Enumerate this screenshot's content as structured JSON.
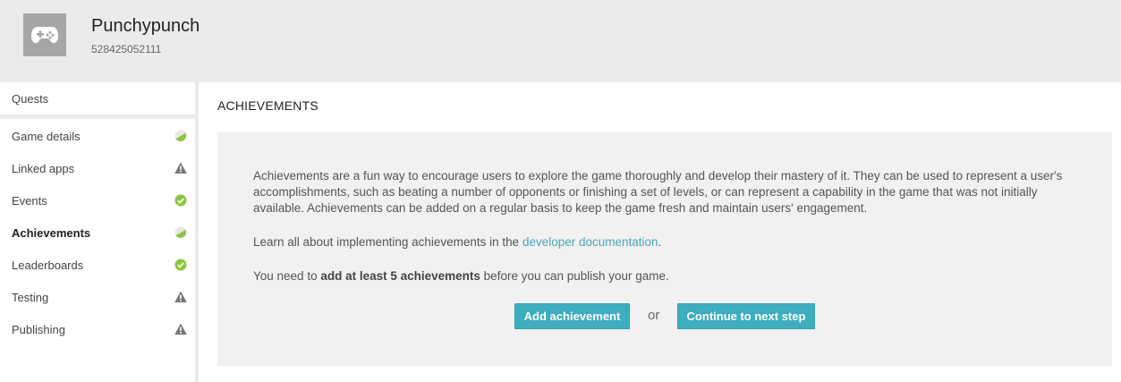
{
  "header": {
    "title": "Punchypunch",
    "game_id": "528425052111",
    "icon": "gamepad-icon"
  },
  "sidebar": {
    "quests_label": "Quests",
    "items": [
      {
        "label": "Game details",
        "status": "partial"
      },
      {
        "label": "Linked apps",
        "status": "warning"
      },
      {
        "label": "Events",
        "status": "complete"
      },
      {
        "label": "Achievements",
        "status": "partial",
        "active": true
      },
      {
        "label": "Leaderboards",
        "status": "complete"
      },
      {
        "label": "Testing",
        "status": "warning"
      },
      {
        "label": "Publishing",
        "status": "warning"
      }
    ]
  },
  "main": {
    "section_title": "ACHIEVEMENTS",
    "description": "Achievements are a fun way to encourage users to explore the game thoroughly and develop their mastery of it. They can be used to represent a user's accomplishments, such as beating a number of opponents or finishing a set of levels, or can represent a capability in the game that was not initially available. Achievements can be added on a regular basis to keep the game fresh and maintain users' engagement.",
    "learn_prefix": "Learn all about implementing achievements in the ",
    "learn_link": "developer documentation",
    "learn_suffix": ".",
    "need_prefix": "You need to ",
    "need_bold": "add at least 5 achievements",
    "need_suffix": " before you can publish your game.",
    "add_button": "Add achievement",
    "or_text": "or",
    "next_button": "Continue to next step"
  },
  "colors": {
    "accent": "#3eadbe",
    "link": "#4aa6b8",
    "complete": "#8cc63f",
    "warning": "#777777"
  }
}
